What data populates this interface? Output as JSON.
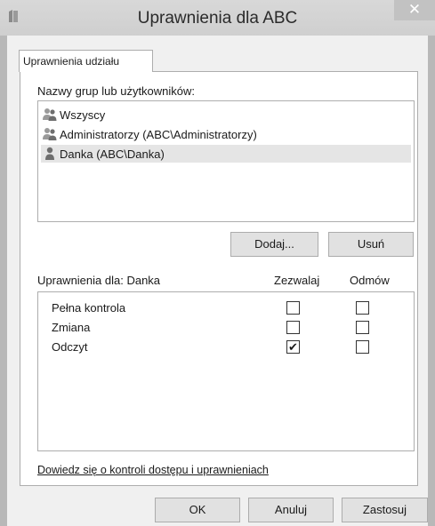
{
  "window": {
    "title": "Uprawnienia dla ABC",
    "close_glyph": "✕"
  },
  "tab": {
    "label": "Uprawnienia udziału"
  },
  "groups": {
    "label": "Nazwy grup lub użytkowników:",
    "items": [
      {
        "label": "Wszyscy",
        "icon": "group-icon",
        "selected": false
      },
      {
        "label": "Administratorzy (ABC\\Administratorzy)",
        "icon": "group-icon",
        "selected": false
      },
      {
        "label": "Danka (ABC\\Danka)",
        "icon": "user-icon",
        "selected": true
      }
    ],
    "add_label": "Dodaj...",
    "remove_label": "Usuń"
  },
  "permissions": {
    "header": "Uprawnienia dla: Danka",
    "allow_header": "Zezwalaj",
    "deny_header": "Odmów",
    "rows": [
      {
        "label": "Pełna kontrola",
        "allow": false,
        "deny": false
      },
      {
        "label": "Zmiana",
        "allow": false,
        "deny": false
      },
      {
        "label": "Odczyt",
        "allow": true,
        "deny": false
      }
    ]
  },
  "link": {
    "label": "Dowiedz się o kontroli dostępu i uprawnieniach"
  },
  "buttons": {
    "ok": "OK",
    "cancel": "Anuluj",
    "apply": "Zastosuj"
  },
  "check_glyph": "✔",
  "colors": {
    "selection": "#e5e5e5",
    "titlebar": "#d4d4d4",
    "client": "#f0f0f0"
  }
}
